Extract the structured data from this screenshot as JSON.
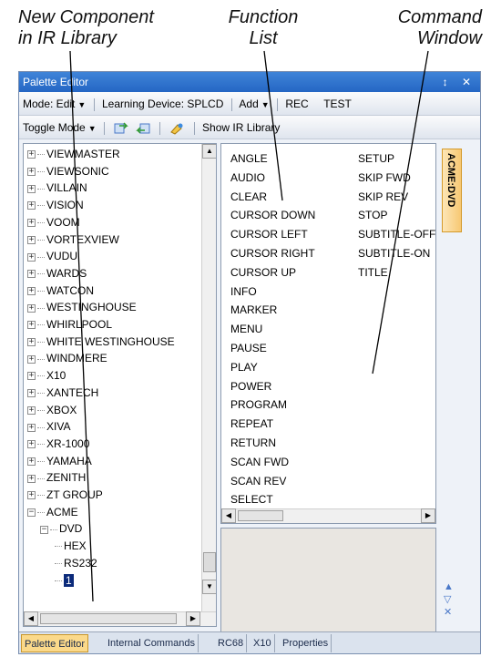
{
  "callouts": {
    "component": [
      "New Component",
      "in IR Library"
    ],
    "function": [
      "Function",
      "List"
    ],
    "command": [
      "Command",
      "Window"
    ]
  },
  "window": {
    "title": "Palette Editor",
    "title_buttons": "↕ ✕"
  },
  "toolbar1": {
    "mode": "Mode: Edit",
    "learning": "Learning Device: SPLCD",
    "add": "Add",
    "rec": "REC",
    "test": "TEST"
  },
  "toolbar2": {
    "toggle": "Toggle Mode",
    "show_ir": "Show IR Library"
  },
  "tree": {
    "items": [
      "VIEWMASTER",
      "VIEWSONIC",
      "VILLAIN",
      "VISION",
      "VOOM",
      "VORTEXVIEW",
      "VUDU",
      "WARDS",
      "WATCON",
      "WESTINGHOUSE",
      "WHIRLPOOL",
      "WHITE WESTINGHOUSE",
      "WINDMERE",
      "X10",
      "XANTECH",
      "XBOX",
      "XIVA",
      "XR-1000",
      "YAMAHA",
      "ZENITH",
      "ZT GROUP"
    ],
    "acme": "ACME",
    "dvd": "DVD",
    "hex": "HEX",
    "rs232": "RS232",
    "one": "1"
  },
  "functions": {
    "col1": [
      "ANGLE",
      "AUDIO",
      "CLEAR",
      "CURSOR DOWN",
      "CURSOR LEFT",
      "CURSOR RIGHT",
      "CURSOR UP",
      "INFO",
      "MARKER",
      "MENU",
      "PAUSE",
      "PLAY",
      "POWER",
      "PROGRAM",
      "REPEAT",
      "RETURN",
      "SCAN FWD",
      "SCAN REV",
      "SELECT"
    ],
    "col2": [
      "SETUP",
      "SKIP FWD",
      "SKIP REV",
      "STOP",
      "SUBTITLE-OFF",
      "SUBTITLE-ON",
      "TITLE"
    ]
  },
  "side": {
    "tab_label": "ACME:DVD",
    "icons": [
      "▲",
      "▽",
      "✕"
    ]
  },
  "tabs": [
    "Palette Editor",
    "Internal Commands",
    "RC68",
    "X10",
    "Properties"
  ],
  "colors": {
    "titlebar": "#2566c4",
    "selection": "#0b2a7a",
    "active_tab": "#fbd98a"
  }
}
